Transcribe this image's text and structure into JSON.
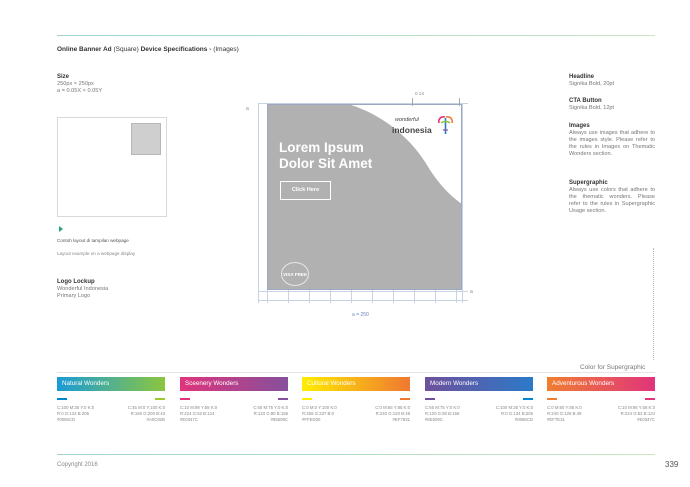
{
  "page": {
    "title_bold_1": "Online Banner Ad",
    "title_normal_1": " (Square) ",
    "title_bold_2": "Device Specifications - ",
    "title_normal_2": "(Images)",
    "copyright": "Copyright 2016",
    "page_number": "339"
  },
  "left": {
    "size_label": "Size",
    "size_line1": "250px × 250px",
    "size_line2": "a = 0.05X × 0.05Y",
    "layout_id": "Contoh layout di tampilan webpage",
    "layout_en": "Layout example on a webpage display",
    "logo_label": "Logo Lockup",
    "logo_line1": "Wonderful Indonesia",
    "logo_line2": "Primary Logo"
  },
  "banner": {
    "headline_line1": "Lorem Ipsum",
    "headline_line2": "Dolor Sit Amet",
    "cta": "Click Here",
    "logo_small": "wonderful",
    "logo_big": "indonesia",
    "stamp": "VISA FREE",
    "dim_top": "0.1X",
    "dim_a": "a",
    "dim_a2": "a",
    "dim_bottom": "a = 250"
  },
  "right": {
    "headline_label": "Headline",
    "headline_value": "Signika Bold, 20pt",
    "cta_label": "CTA Button",
    "cta_value": "Signika Bold, 12pt",
    "images_label": "Images",
    "images_text": "Always use images that adhere to the images style. Please refer to the rules in Images on Thematic Wonders section.",
    "supergraphic_label": "Supergraphic",
    "supergraphic_text": "Always use colors that adhere to the thematic wonders. Please refer to the rules in Supergraphic Usage section."
  },
  "colors": {
    "title": "Color for Supergraphic",
    "swatches": [
      {
        "name": "Natural Wonders",
        "c1": "C:100 M:35 Y:0 K:0\nR:0 G:134 B:205\n#0086CD",
        "c2": "C:45 M:0 Y:100 K:0\nR:160 G:200 B:43\n#A0C82B",
        "start": "#1a9bd7",
        "end": "#8cc63f",
        "chip1": "#0086CD",
        "chip2": "#A0C82B"
      },
      {
        "name": "Sceenery Wonders",
        "c1": "C:10 M:98 Y:58 K:0\nR:224 G:52 B:124\n#E0347C",
        "c2": "C:60 M:75 Y:0 K:0\nR:133 G:80 B:156\n#85509C",
        "start": "#e0347c",
        "end": "#85509c",
        "chip1": "#E0347C",
        "chip2": "#85509C"
      },
      {
        "name": "Cultural Wonders",
        "c1": "C:0 M:0 Y:100 K:0\nR:255 G:237 B:0\n#FFED00",
        "c2": "C:0 M:65 Y:85 K:0\nR:240 G:120 B:49\n#EF7831",
        "start": "#ffed00",
        "end": "#f07831",
        "chip1": "#FFED00",
        "chip2": "#EF7831"
      },
      {
        "name": "Modern Wonders",
        "c1": "C:65 M:75 Y:0 K:0\nR:120 G:80 B:156\n#6E509C",
        "c2": "C:100 M:35 Y:0 K:0\nR:0 G:134 B:205\n#0086CD",
        "start": "#6e509c",
        "end": "#2b7ac8",
        "chip1": "#6E509C",
        "chip2": "#0086CD"
      },
      {
        "name": "Adventurous Wonders",
        "c1": "C:0 M:60 Y:85 K:0\nR:240 G:126 B:49\n#EF7E31",
        "c2": "C:10 M:98 Y:58 K:0\nR:224 G:52 B:124\n#E0347C",
        "start": "#f07e31",
        "end": "#e0347c",
        "chip1": "#EF7E31",
        "chip2": "#E0347C"
      }
    ]
  }
}
